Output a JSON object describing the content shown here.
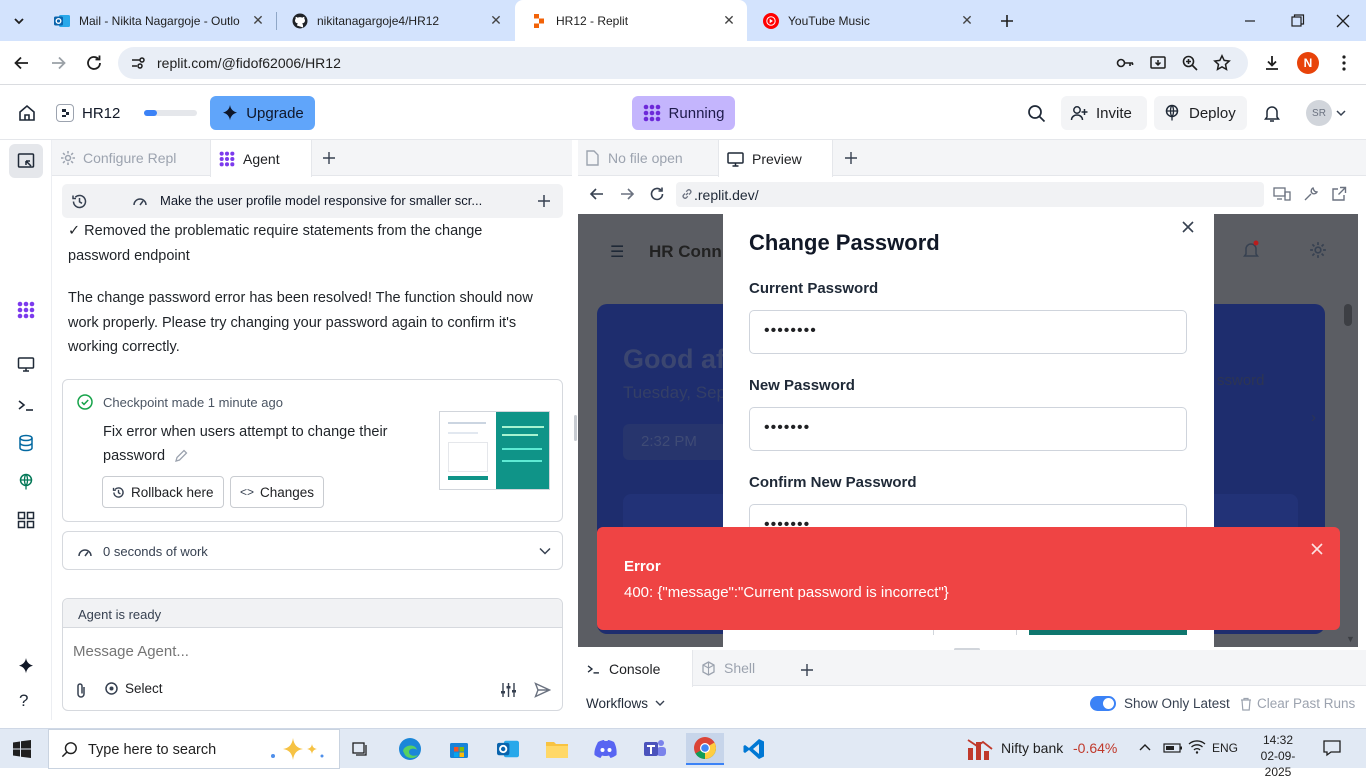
{
  "browser": {
    "tabs": [
      {
        "title": "Mail - Nikita Nagargoje - Outlo",
        "icon": "outlook-icon"
      },
      {
        "title": "nikitanagargoje4/HR12",
        "icon": "github-icon"
      },
      {
        "title": "HR12 - Replit",
        "icon": "replit-icon",
        "active": true
      },
      {
        "title": "YouTube Music",
        "icon": "youtube-music-icon"
      }
    ],
    "url": "replit.com/@fidof62006/HR12",
    "profile_initial": "N"
  },
  "replit": {
    "project_name": "HR12",
    "upgrade_label": "Upgrade",
    "status_label": "Running",
    "invite_label": "Invite",
    "deploy_label": "Deploy",
    "avatar_initials": "SR",
    "accent": "#3b82f6",
    "status_color": "#c4b5fd"
  },
  "agent_panel": {
    "tab_configure": "Configure Repl",
    "tab_agent": "Agent",
    "thread_title": "Make the user profile model responsive for smaller scr...",
    "msg_1": "✓ Removed the problematic require statements from the change password endpoint",
    "msg_2": "The change password error has been resolved! The function should now work properly. Please try changing your password again to confirm it's working correctly.",
    "checkpoint_label": "Checkpoint made 1 minute ago",
    "checkpoint_desc": "Fix error when users attempt to change their password",
    "rollback_label": "Rollback here",
    "changes_label": "Changes",
    "work_label": "0 seconds of work",
    "agent_status": "Agent is ready",
    "message_placeholder": "Message Agent...",
    "select_label": "Select"
  },
  "right_panel": {
    "tab_nofile": "No file open",
    "tab_preview": "Preview",
    "preview_url": ".replit.dev/",
    "background": {
      "header_title": "HR Conn",
      "greeting": "Good af",
      "date": "Tuesday, Sep",
      "time": "2:32 PM",
      "side_text": "ssword"
    },
    "modal": {
      "title": "Change Password",
      "current_label": "Current Password",
      "current_value": "••••••••",
      "new_label": "New Password",
      "new_value": "•••••••",
      "confirm_label": "Confirm New Password",
      "confirm_value": "•••••••"
    },
    "toast": {
      "title": "Error",
      "message": "400: {\"message\":\"Current password is incorrect\"}",
      "color": "#ef4444"
    },
    "console_tab": "Console",
    "shell_tab": "Shell",
    "workflows_label": "Workflows",
    "show_latest_label": "Show Only Latest",
    "clear_runs_label": "Clear Past Runs"
  },
  "taskbar": {
    "search_placeholder": "Type here to search",
    "market_label": "Nifty bank",
    "market_change": "-0.64%",
    "language": "ENG",
    "time": "14:32",
    "date": "02-09-2025"
  }
}
